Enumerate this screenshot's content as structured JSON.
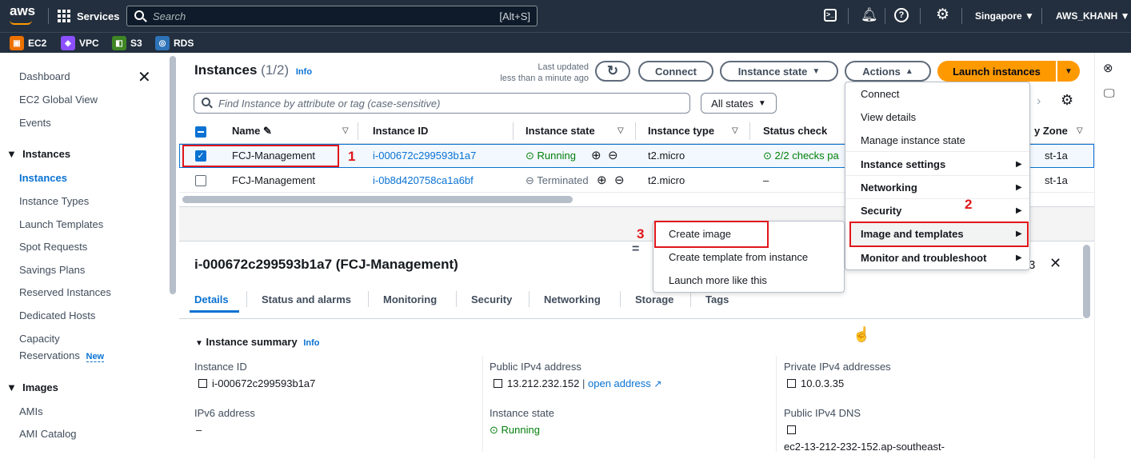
{
  "topnav": {
    "logo": "aws",
    "services": "Services",
    "search_placeholder": "Search",
    "search_shortcut": "[Alt+S]",
    "region": "Singapore ▼",
    "account": "AWS_KHANH ▼"
  },
  "favorites": [
    {
      "label": "EC2",
      "color": "#ed7100",
      "icon": "ec2-icon"
    },
    {
      "label": "VPC",
      "color": "#8c4fff",
      "icon": "vpc-icon"
    },
    {
      "label": "S3",
      "color": "#3f8624",
      "icon": "s3-icon"
    },
    {
      "label": "RDS",
      "color": "#2e73b8",
      "icon": "rds-icon"
    }
  ],
  "sidebar": {
    "items": [
      "Dashboard",
      "EC2 Global View",
      "Events"
    ],
    "section_instances": "Instances",
    "instances_items": [
      "Instances",
      "Instance Types",
      "Launch Templates",
      "Spot Requests",
      "Savings Plans",
      "Reserved Instances",
      "Dedicated Hosts"
    ],
    "capacity_1": "Capacity",
    "capacity_2": "Reservations",
    "new_badge": "New",
    "section_images": "Images",
    "images_items": [
      "AMIs",
      "AMI Catalog"
    ]
  },
  "instances": {
    "title": "Instances",
    "count": "(1/2)",
    "info": "Info",
    "last_updated_1": "Last updated",
    "last_updated_2": "less than a minute ago",
    "connect": "Connect",
    "instance_state": "Instance state",
    "actions": "Actions",
    "launch": "Launch instances",
    "filter_placeholder": "Find Instance by attribute or tag (case-sensitive)",
    "states_filter": "All states",
    "columns": [
      "Name",
      "Instance ID",
      "Instance state",
      "Instance type",
      "Status check",
      "y Zone"
    ],
    "rows": [
      {
        "name": "FCJ-Management",
        "id": "i-000672c299593b1a7",
        "state": "Running",
        "type": "t2.micro",
        "status": "2/2 checks pa",
        "zone": "st-1a"
      },
      {
        "name": "FCJ-Management",
        "id": "i-0b8d420758ca1a6bf",
        "state": "Terminated",
        "type": "t2.micro",
        "status": "–",
        "zone": "st-1a"
      }
    ]
  },
  "actions_menu": {
    "items": [
      "Connect",
      "View details",
      "Manage instance state",
      "Instance settings",
      "Networking",
      "Security",
      "Image and templates",
      "Monitor and troubleshoot"
    ]
  },
  "submenu": {
    "items": [
      "Create image",
      "Create template from instance",
      "Launch more like this"
    ]
  },
  "annotations": [
    "1",
    "2",
    "3"
  ],
  "details": {
    "title": "i-000672c299593b1a7 (FCJ-Management)",
    "tabs": [
      "Details",
      "Status and alarms",
      "Monitoring",
      "Security",
      "Networking",
      "Storage",
      "Tags"
    ],
    "summary": "Instance summary",
    "info": "Info",
    "instance_id_label": "Instance ID",
    "instance_id": "i-000672c299593b1a7",
    "public_ip_label": "Public IPv4 address",
    "public_ip": "13.212.232.152",
    "open_address": "open address",
    "private_ip_label": "Private IPv4 addresses",
    "private_ip": "10.0.3.35",
    "ipv6_label": "IPv6 address",
    "ipv6": "–",
    "state_label": "Instance state",
    "state": "Running",
    "dns_label": "Public IPv4 DNS",
    "dns": "ec2-13-212-232-152.ap-southeast-",
    "close_number": "3"
  }
}
